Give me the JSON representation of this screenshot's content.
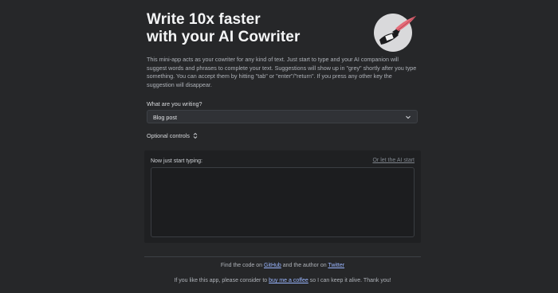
{
  "header": {
    "title_line1": "Write 10x faster",
    "title_line2": "with your AI Cowriter",
    "logo_icon": "quill-hand-icon"
  },
  "intro": {
    "text": "This mini-app acts as your cowriter for any kind of text. Just start to type and your AI companion will suggest words and phrases to complete your text. Suggestions will show up in \"grey\" shortly after you type something. You can accept them by hitting \"tab\" or \"enter\"/\"return\". If you press any other key the suggestion will disappear."
  },
  "form": {
    "label": "What are you writing?",
    "selected_value": "Blog post",
    "optional_controls": "Optional controls"
  },
  "editor": {
    "label": "Now just start typing:",
    "ai_start_link": "Or let the AI start",
    "value": ""
  },
  "footer": {
    "line1_prefix": "Find the code on ",
    "github_link": "GitHub",
    "line1_middle": " and the author on ",
    "twitter_link": "Twitter",
    "line2_prefix": "If you like this app, please consider to ",
    "coffee_link": "buy me a coffee",
    "line2_suffix": " so I can keep it alive. Thank you!"
  },
  "colors": {
    "background": "#262729",
    "panel": "#1f2022",
    "link": "#9ab6ff"
  }
}
